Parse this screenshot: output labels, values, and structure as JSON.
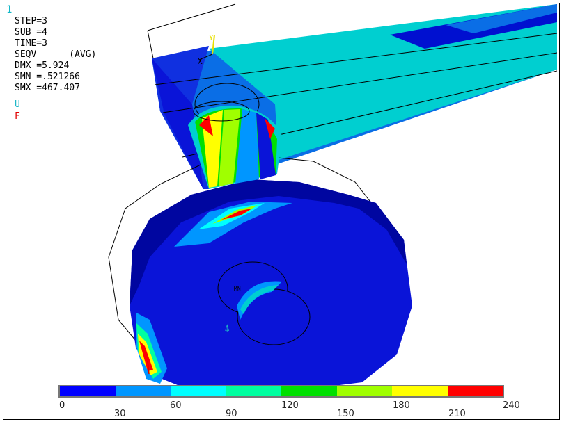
{
  "window_number": "1",
  "info_lines": [
    "STEP=3",
    "SUB =4",
    "TIME=3",
    "SEQV      (AVG)",
    "DMX =5.924",
    "SMN =.521266",
    "SMX =467.407"
  ],
  "legend": {
    "displacement": "U",
    "force": "F"
  },
  "triad_labels": {
    "y": "Y",
    "x": "X"
  },
  "node_label": "MN",
  "colorbar": {
    "colors": [
      "#0000ff",
      "#0096ff",
      "#00ffff",
      "#00ffa0",
      "#00e000",
      "#a0ff00",
      "#ffff00",
      "#ff0000"
    ],
    "labels_top": [
      "0",
      "60",
      "120",
      "180",
      "240"
    ],
    "labels_bottom": [
      "30",
      "90",
      "150",
      "210"
    ]
  },
  "colors": {
    "deep_blue": "#0a14d8",
    "blue": "#0a6ee6",
    "cyan": "#00cfd0",
    "dark_side": "#0006a0"
  }
}
